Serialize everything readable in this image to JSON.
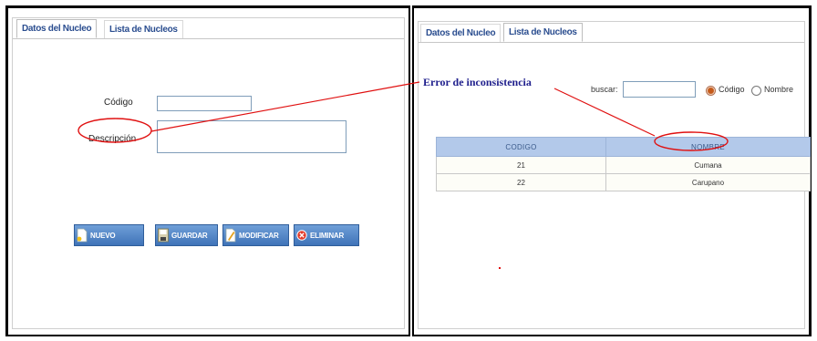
{
  "left_panel": {
    "tabs": [
      {
        "label": "Datos del Nucleo",
        "active": true
      },
      {
        "label": "Lista de Nucleos",
        "active": false
      }
    ],
    "form": {
      "codigo_label": "Código",
      "codigo_value": "",
      "descripcion_label": "Descripción",
      "descripcion_value": ""
    },
    "buttons": [
      {
        "label": "NUEVO",
        "icon": "new-document-icon"
      },
      {
        "label": "GUARDAR",
        "icon": "save-icon"
      },
      {
        "label": "MODIFICAR",
        "icon": "edit-icon"
      },
      {
        "label": "ELIMINAR",
        "icon": "delete-icon"
      }
    ]
  },
  "right_panel": {
    "tabs": [
      {
        "label": "Datos del Nucleo",
        "active": false
      },
      {
        "label": "Lista de Nucleos",
        "active": true
      }
    ],
    "annotation": "Error de inconsistencia",
    "search": {
      "label": "buscar:",
      "value": "",
      "options": [
        {
          "label": "Código",
          "checked": true
        },
        {
          "label": "Nombre",
          "checked": false
        }
      ]
    },
    "table": {
      "columns": [
        "CODIGO",
        "NOMBRE"
      ],
      "rows": [
        [
          "21",
          "Cumana"
        ],
        [
          "22",
          "Carupano"
        ]
      ]
    }
  },
  "colors": {
    "button_top": "#6f9fd8",
    "button_bottom": "#3f73b8",
    "tab_text": "#2a4d8f",
    "table_header": "#b3c9ea",
    "annotation_line": "#e01010",
    "annotation_text": "#1e1e8c"
  }
}
